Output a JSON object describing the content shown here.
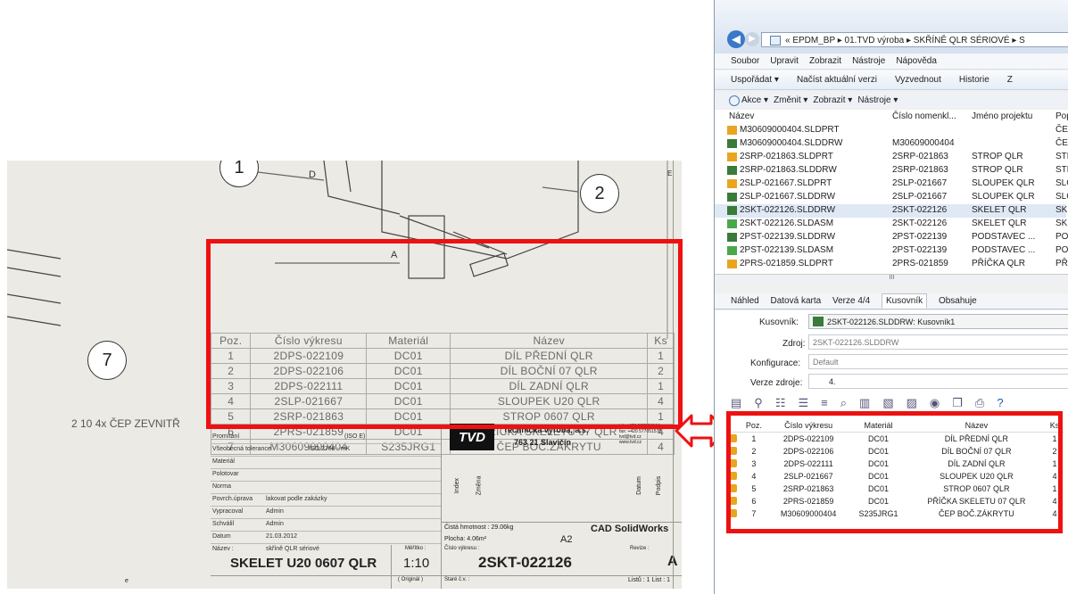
{
  "drawing": {
    "balloons": [
      "1",
      "2",
      "7"
    ],
    "view_labels": {
      "d": "D",
      "a": "A",
      "e": "E"
    },
    "note": "2 10 4x ČEP ZEVNITŘ",
    "bom": {
      "headers": [
        "Poz.",
        "Číslo výkresu",
        "Materiál",
        "Název",
        "Ks"
      ],
      "rows": [
        [
          "1",
          "2DPS-022109",
          "DC01",
          "DÍL PŘEDNÍ QLR",
          "1"
        ],
        [
          "2",
          "2DPS-022106",
          "DC01",
          "DÍL BOČNÍ 07 QLR",
          "2"
        ],
        [
          "3",
          "2DPS-022111",
          "DC01",
          "DÍL ZADNÍ QLR",
          "1"
        ],
        [
          "4",
          "2SLP-021667",
          "DC01",
          "SLOUPEK U20 QLR",
          "4"
        ],
        [
          "5",
          "2SRP-021863",
          "DC01",
          "STROP 0607 QLR",
          "1"
        ],
        [
          "6",
          "2PRS-021859",
          "DC01",
          "PŘÍČKA SKELETU 07 QLR",
          "4"
        ],
        [
          "7",
          "M30609000404",
          "S235JRG1",
          "ČEP BOČ.ZÁKRYTU",
          "4"
        ]
      ]
    },
    "title_block": {
      "company": "Technická výroba, a.s.",
      "address": "763 21 Slavičín",
      "phone": "tel. +420 577051544",
      "fax": "fax: +420 577051570",
      "email": "tvd@tvd.cz",
      "web": "www.tvd.cz",
      "logo": "TVD",
      "fields": [
        [
          "Promítání",
          "(ISO E)"
        ],
        [
          "Všeobecná tolerance",
          "ISO 2768 - mK"
        ],
        [
          "Materiál",
          ""
        ],
        [
          "Polotovar",
          ""
        ],
        [
          "Norma",
          ""
        ],
        [
          "Povrch.úprava",
          "lakovat podle zakázky"
        ],
        [
          "Vypracoval",
          "Admin"
        ],
        [
          "Schválil",
          "Admin"
        ],
        [
          "Datum",
          "21.03.2012"
        ],
        [
          "Název :",
          "skříně QLR sériové"
        ]
      ],
      "index": "Index",
      "zmena": "Změna",
      "datum": "Datum",
      "podpis": "Podpis",
      "weight": "Čistá hmotnost : 29.06kg",
      "area": "Plocha: 4.06m²",
      "format": "A2",
      "cad": "CAD SolidWorks",
      "drawing_no_label": "Číslo výkresu :",
      "drawing_no": "2SKT-022126",
      "revision_label": "Revize :",
      "revision": "A",
      "scale_label": "Měřítko :",
      "scale": "1:10",
      "original": "( Originál )",
      "old_no": "Staré č.v. :",
      "sheet": "Listů : 1 List : 1",
      "title": "SKELET U20 0607 QLR",
      "zone": "e"
    }
  },
  "pdm": {
    "breadcrumb": "« EPDM_BP ▸ 01.TVD výroba ▸ SKŘÍNĚ QLR SÉRIOVÉ ▸ S",
    "menu": [
      "Soubor",
      "Upravit",
      "Zobrazit",
      "Nástroje",
      "Nápověda"
    ],
    "toolbar": [
      "Uspořádat ▾",
      "Načíst aktuální verzi",
      "Vyzvednout",
      "Historie",
      "Z"
    ],
    "actions": [
      "Akce ▾",
      "Změnit ▾",
      "Zobrazit ▾",
      "Nástroje ▾"
    ],
    "columns": [
      "Název",
      "Číslo nomenkl...",
      "Jméno projektu",
      "Pop"
    ],
    "files": [
      {
        "name": "M30609000404.SLDPRT",
        "num": "",
        "proj": "",
        "desc": "ČEI",
        "type": "prt"
      },
      {
        "name": "M30609000404.SLDDRW",
        "num": "M30609000404",
        "proj": "",
        "desc": "ČEI",
        "type": "drw"
      },
      {
        "name": "2SRP-021863.SLDPRT",
        "num": "2SRP-021863",
        "proj": "STROP QLR",
        "desc": "STF",
        "type": "prt"
      },
      {
        "name": "2SRP-021863.SLDDRW",
        "num": "2SRP-021863",
        "proj": "STROP QLR",
        "desc": "STF",
        "type": "drw"
      },
      {
        "name": "2SLP-021667.SLDPRT",
        "num": "2SLP-021667",
        "proj": "SLOUPEK QLR",
        "desc": "SLC",
        "type": "prt"
      },
      {
        "name": "2SLP-021667.SLDDRW",
        "num": "2SLP-021667",
        "proj": "SLOUPEK QLR",
        "desc": "SLC",
        "type": "drw"
      },
      {
        "name": "2SKT-022126.SLDDRW",
        "num": "2SKT-022126",
        "proj": "SKELET QLR",
        "desc": "SKE",
        "type": "drw"
      },
      {
        "name": "2SKT-022126.SLDASM",
        "num": "2SKT-022126",
        "proj": "SKELET QLR",
        "desc": "SKE",
        "type": "asm"
      },
      {
        "name": "2PST-022139.SLDDRW",
        "num": "2PST-022139",
        "proj": "PODSTAVEC ...",
        "desc": "PO",
        "type": "drw"
      },
      {
        "name": "2PST-022139.SLDASM",
        "num": "2PST-022139",
        "proj": "PODSTAVEC ...",
        "desc": "PO",
        "type": "asm"
      },
      {
        "name": "2PRS-021859.SLDPRT",
        "num": "2PRS-021859",
        "proj": "PŘÍČKA QLR",
        "desc": "PŘÍ",
        "type": "prt"
      }
    ],
    "scroll_mark": "III",
    "tabs": [
      "Náhled",
      "Datová karta",
      "Verze 4/4",
      "Kusovník",
      "Obsahuje",
      ""
    ],
    "kusovnik_label": "Kusovník:",
    "kusovnik_value": "2SKT-022126.SLDDRW: Kusovník1",
    "zdroj_label": "Zdroj:",
    "zdroj_value": "2SKT-022126.SLDDRW",
    "konfig_label": "Konfigurace:",
    "konfig_value": "Default",
    "verze_label": "Verze zdroje:",
    "verze_value": "4.",
    "kus_headers": [
      "Poz.",
      "Číslo výkresu",
      "Materiál",
      "Název",
      "Ks"
    ],
    "kus_rows": [
      [
        "1",
        "2DPS-022109",
        "DC01",
        "DÍL PŘEDNÍ QLR",
        "1"
      ],
      [
        "2",
        "2DPS-022106",
        "DC01",
        "DÍL BOČNÍ 07 QLR",
        "2"
      ],
      [
        "3",
        "2DPS-022111",
        "DC01",
        "DÍL ZADNÍ QLR",
        "1"
      ],
      [
        "4",
        "2SLP-021667",
        "DC01",
        "SLOUPEK U20 QLR",
        "4"
      ],
      [
        "5",
        "2SRP-021863",
        "DC01",
        "STROP 0607 QLR",
        "1"
      ],
      [
        "6",
        "2PRS-021859",
        "DC01",
        "PŘÍČKA SKELETU 07 QLR",
        "4"
      ],
      [
        "7",
        "M30609000404",
        "S235JRG1",
        "ČEP BOČ.ZÁKRYTU",
        "4"
      ]
    ]
  },
  "colors": {
    "highlight": "#ee1111",
    "selected_row": "#dfe8f5",
    "drawing_bg": "#ebeae4"
  }
}
